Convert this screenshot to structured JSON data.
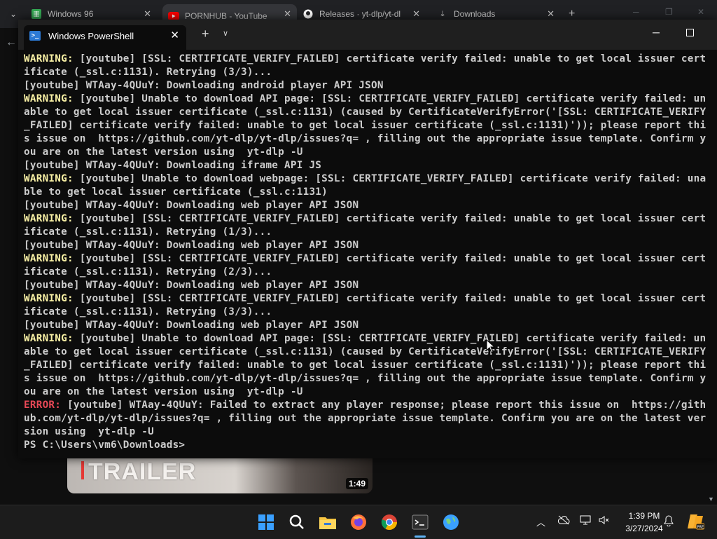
{
  "browser": {
    "tabs": [
      {
        "title": "Windows 96",
        "icon": "spreadsheet-icon",
        "color": "#34a853"
      },
      {
        "title": "PORNHUB - YouTube",
        "icon": "youtube-icon",
        "color": "#ff0000"
      },
      {
        "title": "Releases · yt-dlp/yt-dl",
        "icon": "github-icon",
        "color": "#ffffff"
      },
      {
        "title": "Downloads",
        "icon": "download-icon",
        "color": "#c7c7c7"
      }
    ],
    "new_tab": "+",
    "video": {
      "title": "TRAILER",
      "duration": "1:49"
    }
  },
  "terminal": {
    "tab_title": "Windows PowerShell",
    "tab_icon": "powershell-icon",
    "lines": [
      {
        "prefix": "WARNING:",
        "kind": "warn",
        "text": " [youtube] [SSL: CERTIFICATE_VERIFY_FAILED] certificate verify failed: unable to get local issuer cert"
      },
      {
        "prefix": "",
        "kind": "normal",
        "text": "ificate (_ssl.c:1131). Retrying (3/3)..."
      },
      {
        "prefix": "",
        "kind": "normal",
        "text": "[youtube] WTAay-4QUuY: Downloading android player API JSON"
      },
      {
        "prefix": "WARNING:",
        "kind": "warn",
        "text": " [youtube] Unable to download API page: [SSL: CERTIFICATE_VERIFY_FAILED] certificate verify failed: un"
      },
      {
        "prefix": "",
        "kind": "normal",
        "text": "able to get local issuer certificate (_ssl.c:1131) (caused by CertificateVerifyError('[SSL: CERTIFICATE_VERIFY"
      },
      {
        "prefix": "",
        "kind": "normal",
        "text": "_FAILED] certificate verify failed: unable to get local issuer certificate (_ssl.c:1131)')); please report thi"
      },
      {
        "prefix": "",
        "kind": "normal",
        "text": "s issue on  https://github.com/yt-dlp/yt-dlp/issues?q= , filling out the appropriate issue template. Confirm y"
      },
      {
        "prefix": "",
        "kind": "normal",
        "text": "ou are on the latest version using  yt-dlp -U"
      },
      {
        "prefix": "",
        "kind": "normal",
        "text": "[youtube] WTAay-4QUuY: Downloading iframe API JS"
      },
      {
        "prefix": "WARNING:",
        "kind": "warn",
        "text": " [youtube] Unable to download webpage: [SSL: CERTIFICATE_VERIFY_FAILED] certificate verify failed: una"
      },
      {
        "prefix": "",
        "kind": "normal",
        "text": "ble to get local issuer certificate (_ssl.c:1131)"
      },
      {
        "prefix": "",
        "kind": "normal",
        "text": "[youtube] WTAay-4QUuY: Downloading web player API JSON"
      },
      {
        "prefix": "WARNING:",
        "kind": "warn",
        "text": " [youtube] [SSL: CERTIFICATE_VERIFY_FAILED] certificate verify failed: unable to get local issuer cert"
      },
      {
        "prefix": "",
        "kind": "normal",
        "text": "ificate (_ssl.c:1131). Retrying (1/3)..."
      },
      {
        "prefix": "",
        "kind": "normal",
        "text": "[youtube] WTAay-4QUuY: Downloading web player API JSON"
      },
      {
        "prefix": "WARNING:",
        "kind": "warn",
        "text": " [youtube] [SSL: CERTIFICATE_VERIFY_FAILED] certificate verify failed: unable to get local issuer cert"
      },
      {
        "prefix": "",
        "kind": "normal",
        "text": "ificate (_ssl.c:1131). Retrying (2/3)..."
      },
      {
        "prefix": "",
        "kind": "normal",
        "text": "[youtube] WTAay-4QUuY: Downloading web player API JSON"
      },
      {
        "prefix": "WARNING:",
        "kind": "warn",
        "text": " [youtube] [SSL: CERTIFICATE_VERIFY_FAILED] certificate verify failed: unable to get local issuer cert"
      },
      {
        "prefix": "",
        "kind": "normal",
        "text": "ificate (_ssl.c:1131). Retrying (3/3)..."
      },
      {
        "prefix": "",
        "kind": "normal",
        "text": "[youtube] WTAay-4QUuY: Downloading web player API JSON"
      },
      {
        "prefix": "WARNING:",
        "kind": "warn",
        "text": " [youtube] Unable to download API page: [SSL: CERTIFICATE_VERIFY_FAILED] certificate verify failed: un"
      },
      {
        "prefix": "",
        "kind": "normal",
        "text": "able to get local issuer certificate (_ssl.c:1131) (caused by CertificateVerifyError('[SSL: CERTIFICATE_VERIFY"
      },
      {
        "prefix": "",
        "kind": "normal",
        "text": "_FAILED] certificate verify failed: unable to get local issuer certificate (_ssl.c:1131)')); please report thi"
      },
      {
        "prefix": "",
        "kind": "normal",
        "text": "s issue on  https://github.com/yt-dlp/yt-dlp/issues?q= , filling out the appropriate issue template. Confirm y"
      },
      {
        "prefix": "",
        "kind": "normal",
        "text": "ou are on the latest version using  yt-dlp -U"
      },
      {
        "prefix": "ERROR:",
        "kind": "err",
        "text": " [youtube] WTAay-4QUuY: Failed to extract any player response; please report this issue on  https://gith"
      },
      {
        "prefix": "",
        "kind": "normal",
        "text": "ub.com/yt-dlp/yt-dlp/issues?q= , filling out the appropriate issue template. Confirm you are on the latest ver"
      },
      {
        "prefix": "",
        "kind": "normal",
        "text": "sion using  yt-dlp -U"
      },
      {
        "prefix": "",
        "kind": "normal",
        "text": "PS C:\\Users\\vm6\\Downloads>"
      }
    ]
  },
  "taskbar": {
    "apps": [
      "start-icon",
      "search-icon",
      "file-explorer-icon",
      "firefox-icon",
      "chrome-icon",
      "terminal-icon",
      "globe-icon"
    ],
    "tray": [
      "chevron-up-icon",
      "cloud-offline-icon",
      "display-icon",
      "volume-muted-icon"
    ],
    "time": "1:39 PM",
    "date": "3/27/2024",
    "notification_icon": "bell-icon"
  },
  "colors": {
    "warning": "#f9f1a5",
    "error": "#e74856",
    "text": "#cccccc",
    "accent": "#5fb2f2"
  }
}
